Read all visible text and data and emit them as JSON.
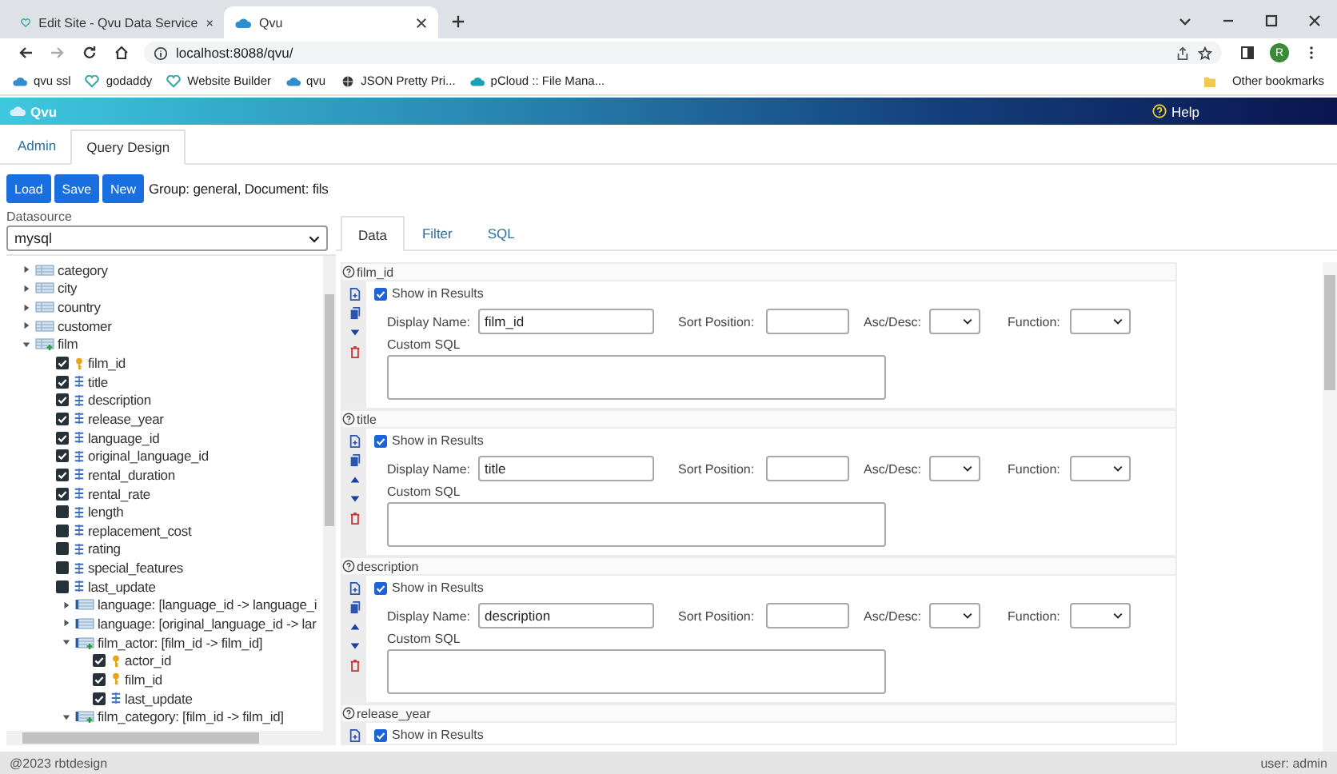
{
  "browser": {
    "tabs": [
      {
        "title": "Edit Site - Qvu Data Service",
        "selected": false
      },
      {
        "title": "Qvu",
        "selected": true
      }
    ],
    "url": "localhost:8088/qvu/",
    "profile_initial": "R",
    "bookmarks": [
      {
        "label": "qvu ssl",
        "kind": "cloud"
      },
      {
        "label": "godaddy",
        "kind": "heart"
      },
      {
        "label": "Website Builder",
        "kind": "heart"
      },
      {
        "label": "qvu",
        "kind": "cloud"
      },
      {
        "label": "JSON Pretty Pri...",
        "kind": "globe"
      },
      {
        "label": "pCloud :: File Mana...",
        "kind": "pcloud"
      }
    ],
    "other_bookmarks": "Other bookmarks"
  },
  "app": {
    "title": "Qvu",
    "help": "Help"
  },
  "main_tabs": [
    {
      "label": "Admin",
      "selected": false
    },
    {
      "label": "Query Design",
      "selected": true
    }
  ],
  "toolbar": {
    "buttons": [
      "Load",
      "Save",
      "New"
    ],
    "info": "Group: general, Document: fils"
  },
  "datasource": {
    "label": "Datasource",
    "value": "mysql"
  },
  "tree": [
    {
      "label": "category",
      "kind": "table",
      "expanded": false
    },
    {
      "label": "city",
      "kind": "table",
      "expanded": false
    },
    {
      "label": "country",
      "kind": "table",
      "expanded": false
    },
    {
      "label": "customer",
      "kind": "table",
      "expanded": false
    },
    {
      "label": "film",
      "kind": "table",
      "expanded": true,
      "children": [
        {
          "label": "film_id",
          "kind": "key",
          "checked": true
        },
        {
          "label": "title",
          "kind": "column",
          "checked": true
        },
        {
          "label": "description",
          "kind": "column",
          "checked": true
        },
        {
          "label": "release_year",
          "kind": "column",
          "checked": true
        },
        {
          "label": "language_id",
          "kind": "column",
          "checked": true
        },
        {
          "label": "original_language_id",
          "kind": "column",
          "checked": true
        },
        {
          "label": "rental_duration",
          "kind": "column",
          "checked": true
        },
        {
          "label": "rental_rate",
          "kind": "column",
          "checked": true
        },
        {
          "label": "length",
          "kind": "column",
          "checked": false
        },
        {
          "label": "replacement_cost",
          "kind": "column",
          "checked": false
        },
        {
          "label": "rating",
          "kind": "column",
          "checked": false
        },
        {
          "label": "special_features",
          "kind": "column",
          "checked": false
        },
        {
          "label": "last_update",
          "kind": "column",
          "checked": false
        },
        {
          "label": "language: [language_id -> language_i",
          "kind": "relation",
          "expanded": false
        },
        {
          "label": "language: [original_language_id -> lar",
          "kind": "relation",
          "expanded": false
        },
        {
          "label": "film_actor: [film_id -> film_id]",
          "kind": "relation",
          "expanded": true,
          "children": [
            {
              "label": "actor_id",
              "kind": "key",
              "checked": true
            },
            {
              "label": "film_id",
              "kind": "key",
              "checked": true
            },
            {
              "label": "last_update",
              "kind": "column",
              "checked": true
            }
          ]
        },
        {
          "label": "film_category: [film_id -> film_id]",
          "kind": "relation",
          "expanded": true
        }
      ]
    }
  ],
  "design_tabs": [
    {
      "label": "Data",
      "selected": true
    },
    {
      "label": "Filter",
      "selected": false
    },
    {
      "label": "SQL",
      "selected": false
    }
  ],
  "fields": [
    {
      "name": "film_id",
      "actions": [
        {
          "kind": "add"
        },
        {
          "kind": "copy"
        },
        {
          "kind": "down"
        },
        {
          "kind": "delete"
        }
      ],
      "show_label": "Show in Results",
      "show_in_results": true,
      "display_label": "Display Name:",
      "display_name": "film_id",
      "sort_label": "Sort Position:",
      "order_label": "Asc/Desc:",
      "function_label": "Function:",
      "custom_sql_label": "Custom SQL"
    },
    {
      "name": "title",
      "actions": [
        {
          "kind": "add"
        },
        {
          "kind": "copy"
        },
        {
          "kind": "up"
        },
        {
          "kind": "down"
        },
        {
          "kind": "delete"
        }
      ],
      "show_label": "Show in Results",
      "show_in_results": true,
      "display_label": "Display Name:",
      "display_name": "title",
      "sort_label": "Sort Position:",
      "order_label": "Asc/Desc:",
      "function_label": "Function:",
      "custom_sql_label": "Custom SQL"
    },
    {
      "name": "description",
      "actions": [
        {
          "kind": "add"
        },
        {
          "kind": "copy"
        },
        {
          "kind": "up"
        },
        {
          "kind": "down"
        },
        {
          "kind": "delete"
        }
      ],
      "show_label": "Show in Results",
      "show_in_results": true,
      "display_label": "Display Name:",
      "display_name": "description",
      "sort_label": "Sort Position:",
      "order_label": "Asc/Desc:",
      "function_label": "Function:",
      "custom_sql_label": "Custom SQL"
    },
    {
      "name": "release_year",
      "actions": [
        {
          "kind": "add"
        }
      ],
      "show_label": "Show in Results",
      "show_in_results": true
    }
  ],
  "footer": {
    "copyright": "@2023 rbtdesign",
    "user": "user: admin"
  }
}
